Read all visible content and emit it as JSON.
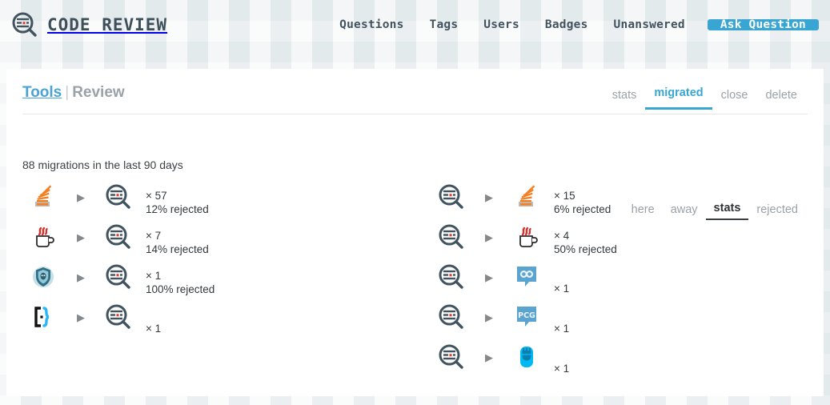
{
  "header": {
    "brand_title": "CODE REVIEW",
    "logo_icon": "code-review-logo-icon",
    "nav": [
      {
        "label": "Questions"
      },
      {
        "label": "Tags"
      },
      {
        "label": "Users"
      },
      {
        "label": "Badges"
      },
      {
        "label": "Unanswered"
      }
    ],
    "ask_button": "Ask Question",
    "accent_color": "#39a5d2"
  },
  "breadcrumb": {
    "tools": "Tools",
    "separator": "|",
    "current": "Review"
  },
  "main_tabs": [
    {
      "label": "stats",
      "active": false
    },
    {
      "label": "migrated",
      "active": true
    },
    {
      "label": "close",
      "active": false
    },
    {
      "label": "delete",
      "active": false
    }
  ],
  "sub_tabs": [
    {
      "label": "here",
      "active": false
    },
    {
      "label": "away",
      "active": false
    },
    {
      "label": "stats",
      "active": true
    },
    {
      "label": "rejected",
      "active": false
    }
  ],
  "summary": "88 migrations in the last 90 days",
  "arrow_glyph": "▶",
  "migrations": {
    "left_column": [
      {
        "from_icon": "stack-overflow-icon",
        "to_icon": "code-review-icon",
        "count": "× 57",
        "rejected": "12% rejected"
      },
      {
        "from_icon": "java-coffee-cup-icon",
        "to_icon": "code-review-icon",
        "count": "× 7",
        "rejected": "14% rejected"
      },
      {
        "from_icon": "information-security-shield-icon",
        "to_icon": "code-review-icon",
        "count": "× 1",
        "rejected": "100% rejected"
      },
      {
        "from_icon": "code-golf-brackets-icon",
        "to_icon": "code-review-icon",
        "count": "× 1",
        "rejected": ""
      }
    ],
    "right_column": [
      {
        "from_icon": "code-review-icon",
        "to_icon": "stack-overflow-icon",
        "count": "× 15",
        "rejected": "6% rejected"
      },
      {
        "from_icon": "code-review-icon",
        "to_icon": "java-coffee-cup-icon",
        "count": "× 4",
        "rejected": "50% rejected"
      },
      {
        "from_icon": "code-review-icon",
        "to_icon": "mathematics-infinity-icon",
        "count": "× 1",
        "rejected": ""
      },
      {
        "from_icon": "code-review-icon",
        "to_icon": "pcg-puzzling-icon",
        "count": "× 1",
        "rejected": ""
      },
      {
        "from_icon": "code-review-icon",
        "to_icon": "robot-avatar-icon",
        "count": "× 1",
        "rejected": ""
      }
    ]
  }
}
